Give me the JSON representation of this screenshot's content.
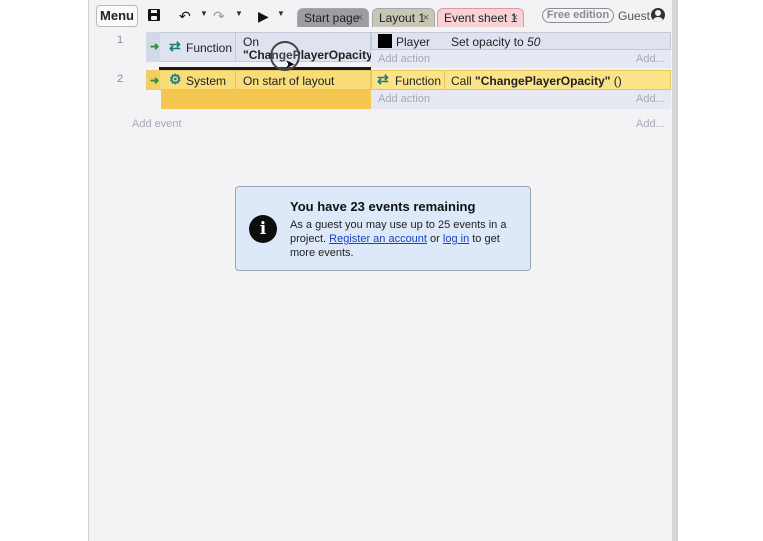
{
  "toolbar": {
    "menu_label": "Menu",
    "tabs": [
      {
        "label": "Start page"
      },
      {
        "label": "Layout 1"
      },
      {
        "label": "Event sheet 1"
      }
    ],
    "tab_close": "×",
    "free_edition_label": "Free edition",
    "guest_label": "Guest"
  },
  "events": [
    {
      "number": "1",
      "condition": {
        "object": "Function",
        "text_line1": "On",
        "text_line2": "\"ChangePlayerOpacity\""
      },
      "action": {
        "object": "Player",
        "text_prefix": "Set opacity to ",
        "text_value": "50"
      }
    },
    {
      "number": "2",
      "condition": {
        "object": "System",
        "text": "On start of layout"
      },
      "action": {
        "object": "Function",
        "text_prefix": "Call ",
        "text_bold": "\"ChangePlayerOpacity\"",
        "text_suffix": " ()"
      }
    }
  ],
  "sheet": {
    "add_action": "Add action",
    "add": "Add...",
    "add_event": "Add event"
  },
  "notice": {
    "title": "You have 23 events remaining",
    "body_prefix": "As a guest you may use up to 25 events in a project. ",
    "register_link": "Register an account",
    "or_text": " or ",
    "login_link": "log in",
    "body_suffix": " to get more events."
  },
  "colors": {
    "event1_bg": "#dfe3ef",
    "event2_bg": "#f8dd7a",
    "notice_bg": "#dde8f8",
    "active_tab_bg": "#f9d2d6",
    "link": "#1a44c8"
  }
}
